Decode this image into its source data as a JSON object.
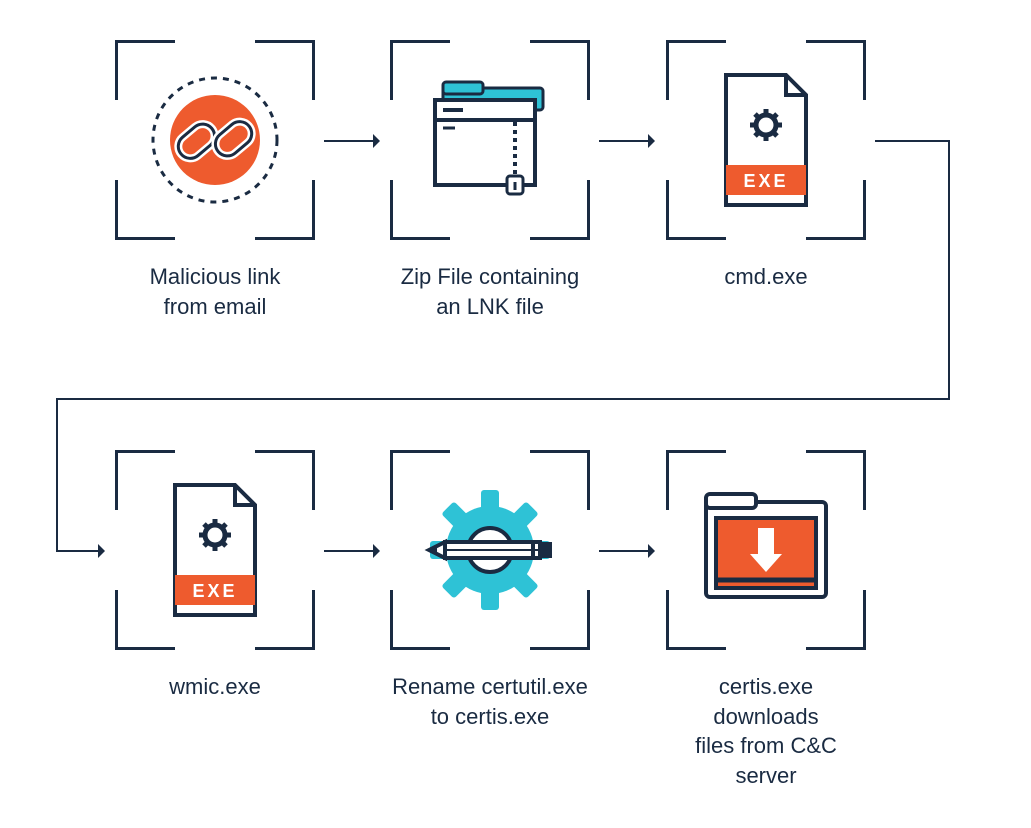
{
  "colors": {
    "stroke": "#1a2b42",
    "orange": "#ee5b2e",
    "cyan": "#2ec2d6",
    "white": "#ffffff"
  },
  "flow": {
    "order": [
      "malicious-link",
      "zip-file",
      "cmd-exe",
      "wmic-exe",
      "rename-certutil",
      "certis-downloads"
    ],
    "direction": "left-to-right then wrap down-left then left-to-right"
  },
  "nodes": {
    "malicious_link": {
      "label_line1": "Malicious link",
      "label_line2": "from email",
      "icon_name": "chain-link-icon"
    },
    "zip_file": {
      "label_line1": "Zip File containing",
      "label_line2": "an LNK file",
      "icon_name": "zip-folder-icon"
    },
    "cmd_exe": {
      "label_line1": "cmd.exe",
      "label_line2": "",
      "icon_name": "exe-file-icon",
      "badge_text": "EXE"
    },
    "wmic_exe": {
      "label_line1": "wmic.exe",
      "label_line2": "",
      "icon_name": "exe-file-icon",
      "badge_text": "EXE"
    },
    "rename_certutil": {
      "label_line1": "Rename certutil.exe",
      "label_line2": "to certis.exe",
      "icon_name": "gear-pencil-icon"
    },
    "certis_downloads": {
      "label_line1": "certis.exe downloads",
      "label_line2": "files from C&C server",
      "icon_name": "download-folder-icon"
    }
  }
}
